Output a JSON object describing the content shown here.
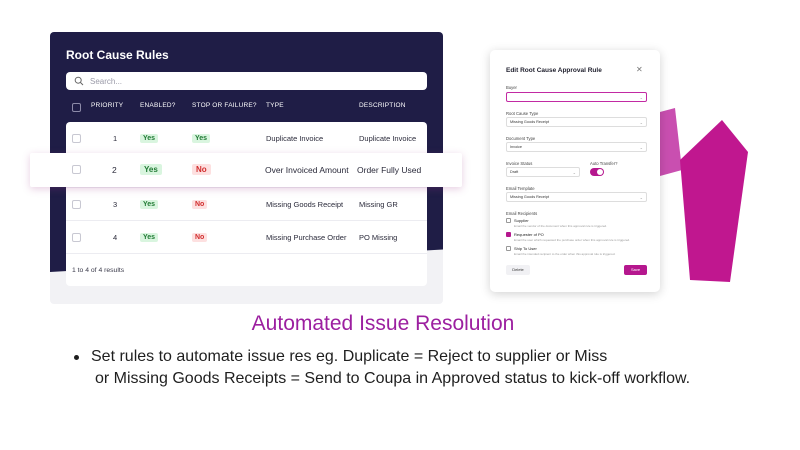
{
  "rules_panel": {
    "title": "Root Cause Rules",
    "search_placeholder": "Search...",
    "headers": [
      "PRIORITY",
      "ENABLED?",
      "STOP OR FAILURE?",
      "TYPE",
      "DESCRIPTION"
    ],
    "rows": [
      {
        "priority": "1",
        "enabled": "Yes",
        "stop": "Yes",
        "type": "Duplicate Invoice",
        "description": "Duplicate Invoice"
      },
      {
        "priority": "2",
        "enabled": "Yes",
        "stop": "No",
        "type": "Over Invoiced Amount",
        "description": "Order Fully Used"
      },
      {
        "priority": "3",
        "enabled": "Yes",
        "stop": "No",
        "type": "Missing Goods Receipt",
        "description": "Missing GR"
      },
      {
        "priority": "4",
        "enabled": "Yes",
        "stop": "No",
        "type": "Missing Purchase Order",
        "description": "PO Missing"
      }
    ],
    "footer": "1 to 4 of 4 results",
    "colors": {
      "dark": "#1f1d46",
      "yes": "#1f7a33",
      "no": "#d12c2c"
    }
  },
  "modal": {
    "title": "Edit Root Cause Approval Rule",
    "close_icon": "close-icon",
    "buyer_label": "Buyer",
    "buyer_value": "",
    "root_cause_type_label": "Root Cause Type",
    "root_cause_type_value": "Missing Goods Receipt",
    "document_type_label": "Document Type",
    "document_type_value": "Invoice",
    "invoice_status_label": "Invoice Status",
    "invoice_status_value": "Draft",
    "auto_transfer_label": "Auto Transfer?",
    "email_template_label": "Email Template",
    "email_template_value": "Missing Goods Receipt",
    "email_recipients_label": "Email Recipients",
    "recipients": [
      {
        "label": "Supplier",
        "desc": "Email the vendor of the document when this approval rule is triggered.",
        "checked": false
      },
      {
        "label": "Requester of PO",
        "desc": "Email the user which requested the purchase order when this approval rule is triggered.",
        "checked": true
      },
      {
        "label": "Ship To User",
        "desc": "Email the intended recipient to the order when this approval rule is triggered.",
        "checked": false
      }
    ],
    "delete_label": "Delete",
    "save_label": "Save",
    "accent": "#b5178e"
  },
  "caption": {
    "headline": "Automated Issue Resolution",
    "bullet_line1": "Set rules to automate issue res eg. Duplicate = Reject to supplier or Miss",
    "bullet_line2": "or Missing Goods Receipts = Send to Coupa in Approved status to kick-off workflow.",
    "headline_color": "#9c1fa0"
  }
}
